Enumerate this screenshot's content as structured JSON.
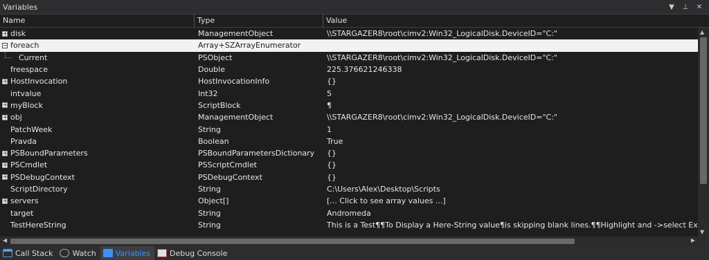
{
  "panel": {
    "title": "Variables",
    "icons": [
      "dropdown-icon",
      "pin-icon",
      "close-icon"
    ]
  },
  "columns": {
    "name": "Name",
    "type": "Type",
    "value": "Value"
  },
  "rows": [
    {
      "name": "disk",
      "type": "ManagementObject",
      "value": "\\\\STARGAZER8\\root\\cimv2:Win32_LogicalDisk.DeviceID=\"C:\"",
      "expander": "+"
    },
    {
      "name": "foreach",
      "type": "Array+SZArrayEnumerator",
      "value": "",
      "expander": "−",
      "selected": true
    },
    {
      "name": "Current",
      "type": "PSObject",
      "value": "\\\\STARGAZER8\\root\\cimv2:Win32_LogicalDisk.DeviceID=\"C:\"",
      "child": true
    },
    {
      "name": "freespace",
      "type": "Double",
      "value": "225.376621246338"
    },
    {
      "name": "HostInvocation",
      "type": "HostInvocationInfo",
      "value": "{}",
      "expander": "+"
    },
    {
      "name": "intvalue",
      "type": "Int32",
      "value": "5"
    },
    {
      "name": "myBlock",
      "type": "ScriptBlock",
      "value": "¶",
      "expander": "+"
    },
    {
      "name": "obj",
      "type": "ManagementObject",
      "value": "\\\\STARGAZER8\\root\\cimv2:Win32_LogicalDisk.DeviceID=\"C:\"",
      "expander": "+"
    },
    {
      "name": "PatchWeek",
      "type": "String",
      "value": "1"
    },
    {
      "name": "Pravda",
      "type": "Boolean",
      "value": "True"
    },
    {
      "name": "PSBoundParameters",
      "type": "PSBoundParametersDictionary",
      "value": "{}",
      "expander": "+"
    },
    {
      "name": "PSCmdlet",
      "type": "PSScriptCmdlet",
      "value": "{}",
      "expander": "+"
    },
    {
      "name": "PSDebugContext",
      "type": "PSDebugContext",
      "value": "{}",
      "expander": "+"
    },
    {
      "name": "ScriptDirectory",
      "type": "String",
      "value": "C:\\Users\\Alex\\Desktop\\Scripts"
    },
    {
      "name": "servers",
      "type": "Object[]",
      "value": "[... Click to see array values ...]",
      "expander": "+"
    },
    {
      "name": "target",
      "type": "String",
      "value": "Andromeda"
    },
    {
      "name": "TestHereString",
      "type": "String",
      "value": "This is a Test¶¶To Display a Here-String value¶is skipping blank lines.¶¶Highlight and ->select Execute selection"
    }
  ],
  "tabs": [
    {
      "label": "Call Stack",
      "icon": "callstack-icon",
      "active": false
    },
    {
      "label": "Watch",
      "icon": "watch-icon",
      "active": false
    },
    {
      "label": "Variables",
      "icon": "variables-icon",
      "active": true
    },
    {
      "label": "Debug Console",
      "icon": "debug-console-icon",
      "active": false
    }
  ],
  "colors": {
    "background": "#1e1e1e",
    "selected_row": "#f2f2f2",
    "active_tab": "#3794ff"
  }
}
